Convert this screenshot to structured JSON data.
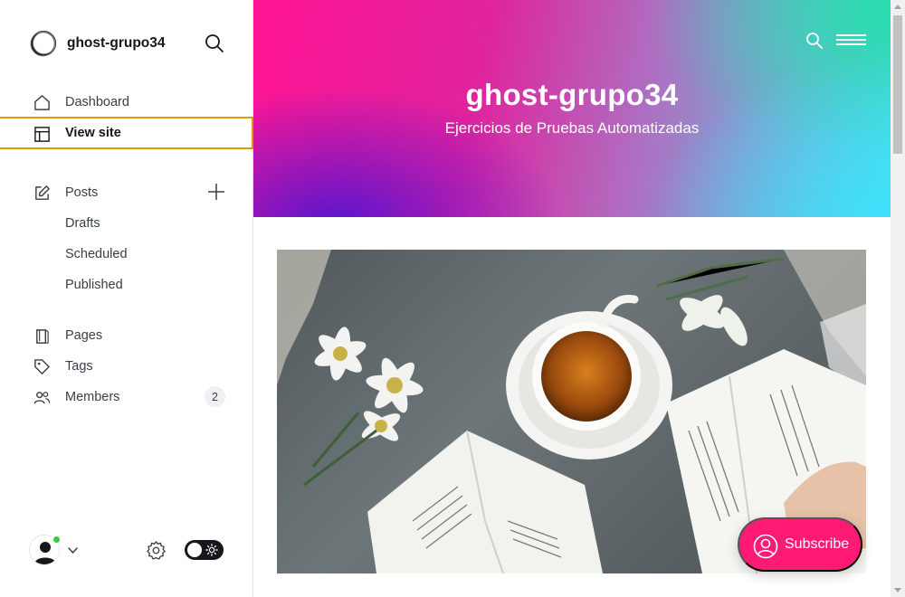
{
  "sidebar": {
    "brand_name": "ghost-grupo34",
    "nav": {
      "dashboard": "Dashboard",
      "view_site": "View site",
      "posts": "Posts",
      "drafts": "Drafts",
      "scheduled": "Scheduled",
      "published": "Published",
      "pages": "Pages",
      "tags": "Tags",
      "members": "Members"
    },
    "members_count": "2",
    "theme_toggle": "dark-mode-on"
  },
  "site": {
    "title": "ghost-grupo34",
    "description": "Ejercicios de Pruebas Automatizadas",
    "subscribe_label": "Subscribe"
  },
  "colors": {
    "active_outline": "#e09a00",
    "online_dot": "#30cf43",
    "subscribe_bg": "#ff1a75"
  },
  "icons": {
    "brand": "ghost-logo-circle",
    "search": "search-icon",
    "dashboard": "house-icon",
    "view_site": "layout-icon",
    "posts": "pencil-icon",
    "add": "plus-icon",
    "pages": "page-icon",
    "tags": "tag-icon",
    "members": "users-icon",
    "settings": "gear-icon",
    "menu": "hamburger-icon",
    "subscribe": "user-circle-icon"
  }
}
